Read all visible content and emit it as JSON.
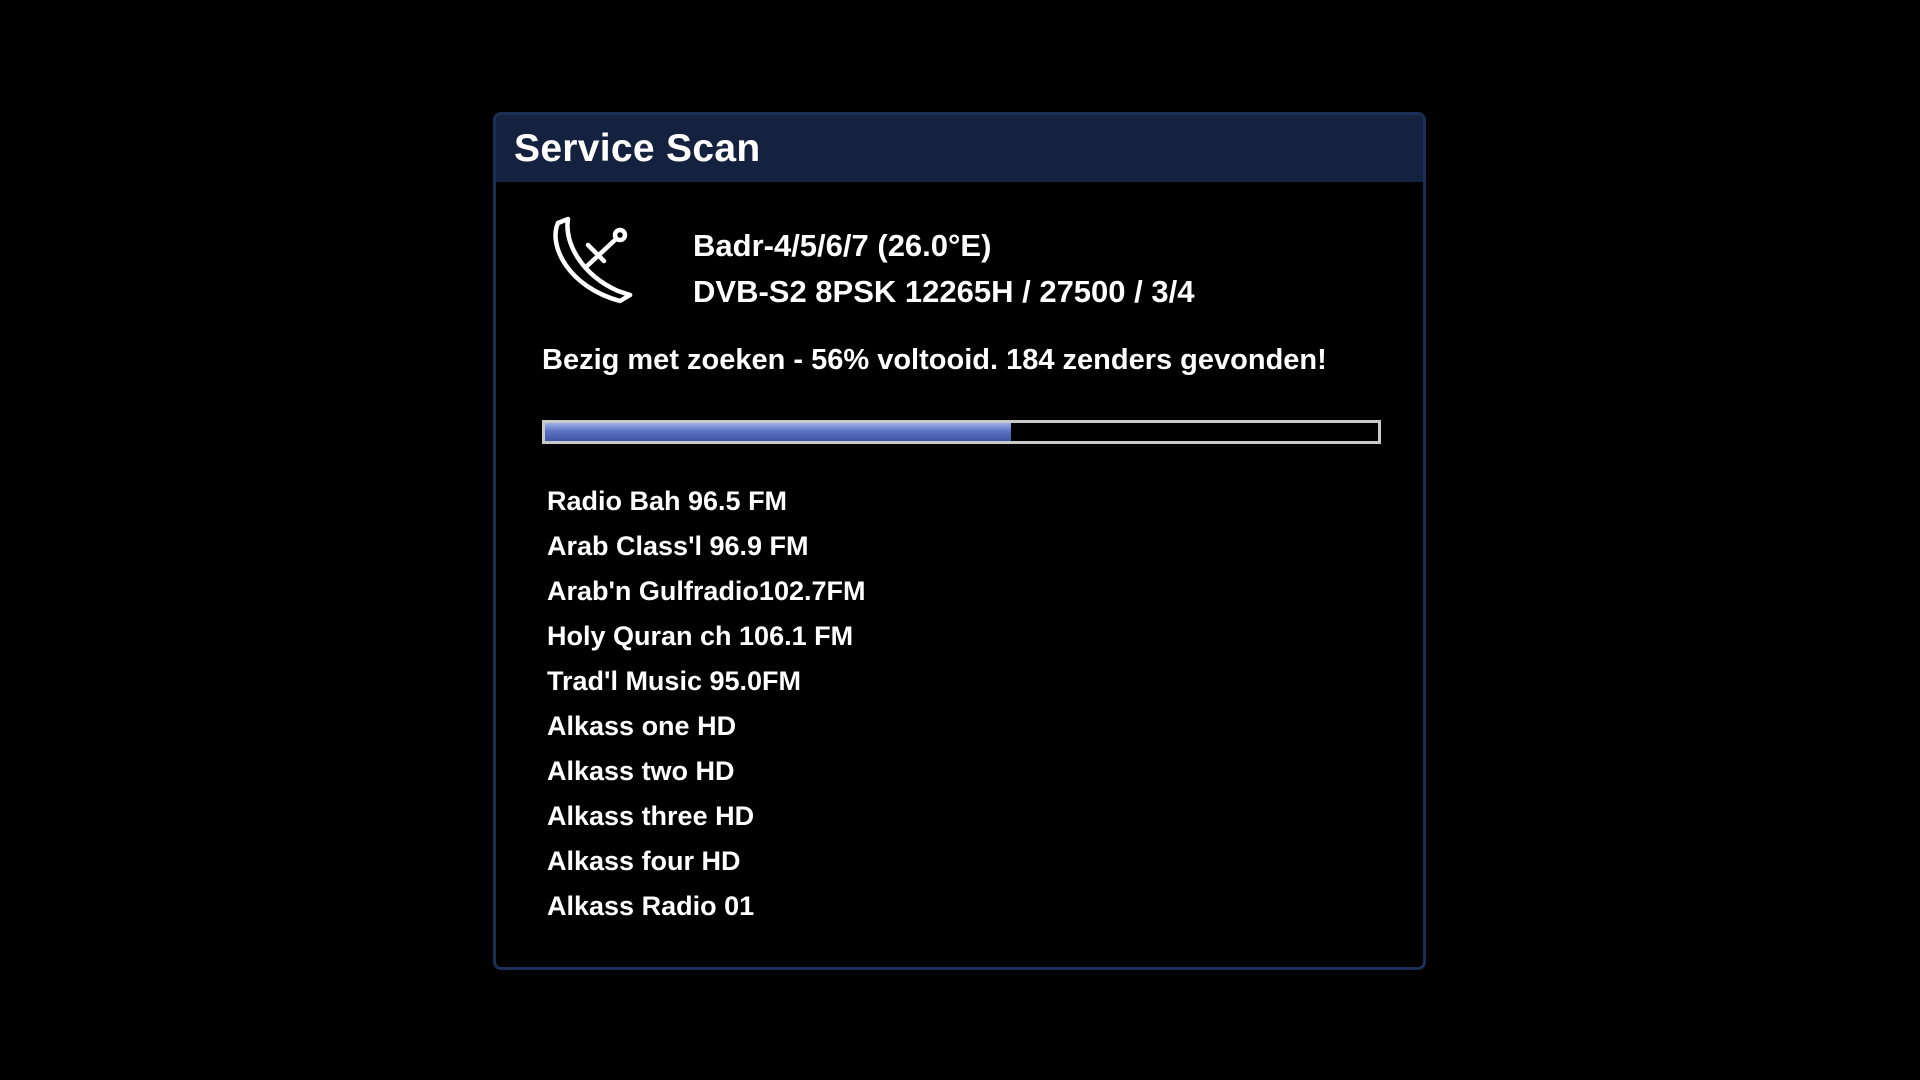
{
  "dialog": {
    "title": "Service Scan"
  },
  "satellite": {
    "icon": "satellite-dish-icon",
    "name": "Badr-4/5/6/7 (26.0°E)",
    "transponder": "DVB-S2 8PSK 12265H / 27500 / 3/4"
  },
  "scan": {
    "status": "Bezig met zoeken - 56% voltooid. 184 zenders gevonden!",
    "progress_percent": 56
  },
  "services": [
    "Radio Bah 96.5 FM",
    "Arab Class'l 96.9 FM",
    "Arab'n Gulfradio102.7FM",
    "Holy Quran ch 106.1 FM",
    "Trad'l Music 95.0FM",
    "Alkass one HD",
    "Alkass two HD",
    "Alkass three HD",
    "Alkass four HD",
    "Alkass Radio 01"
  ],
  "colors": {
    "background": "#000000",
    "titlebar": "#14213f",
    "border": "#1b2f57",
    "progress_fill": "#5b73c2",
    "text": "#ffffff"
  }
}
